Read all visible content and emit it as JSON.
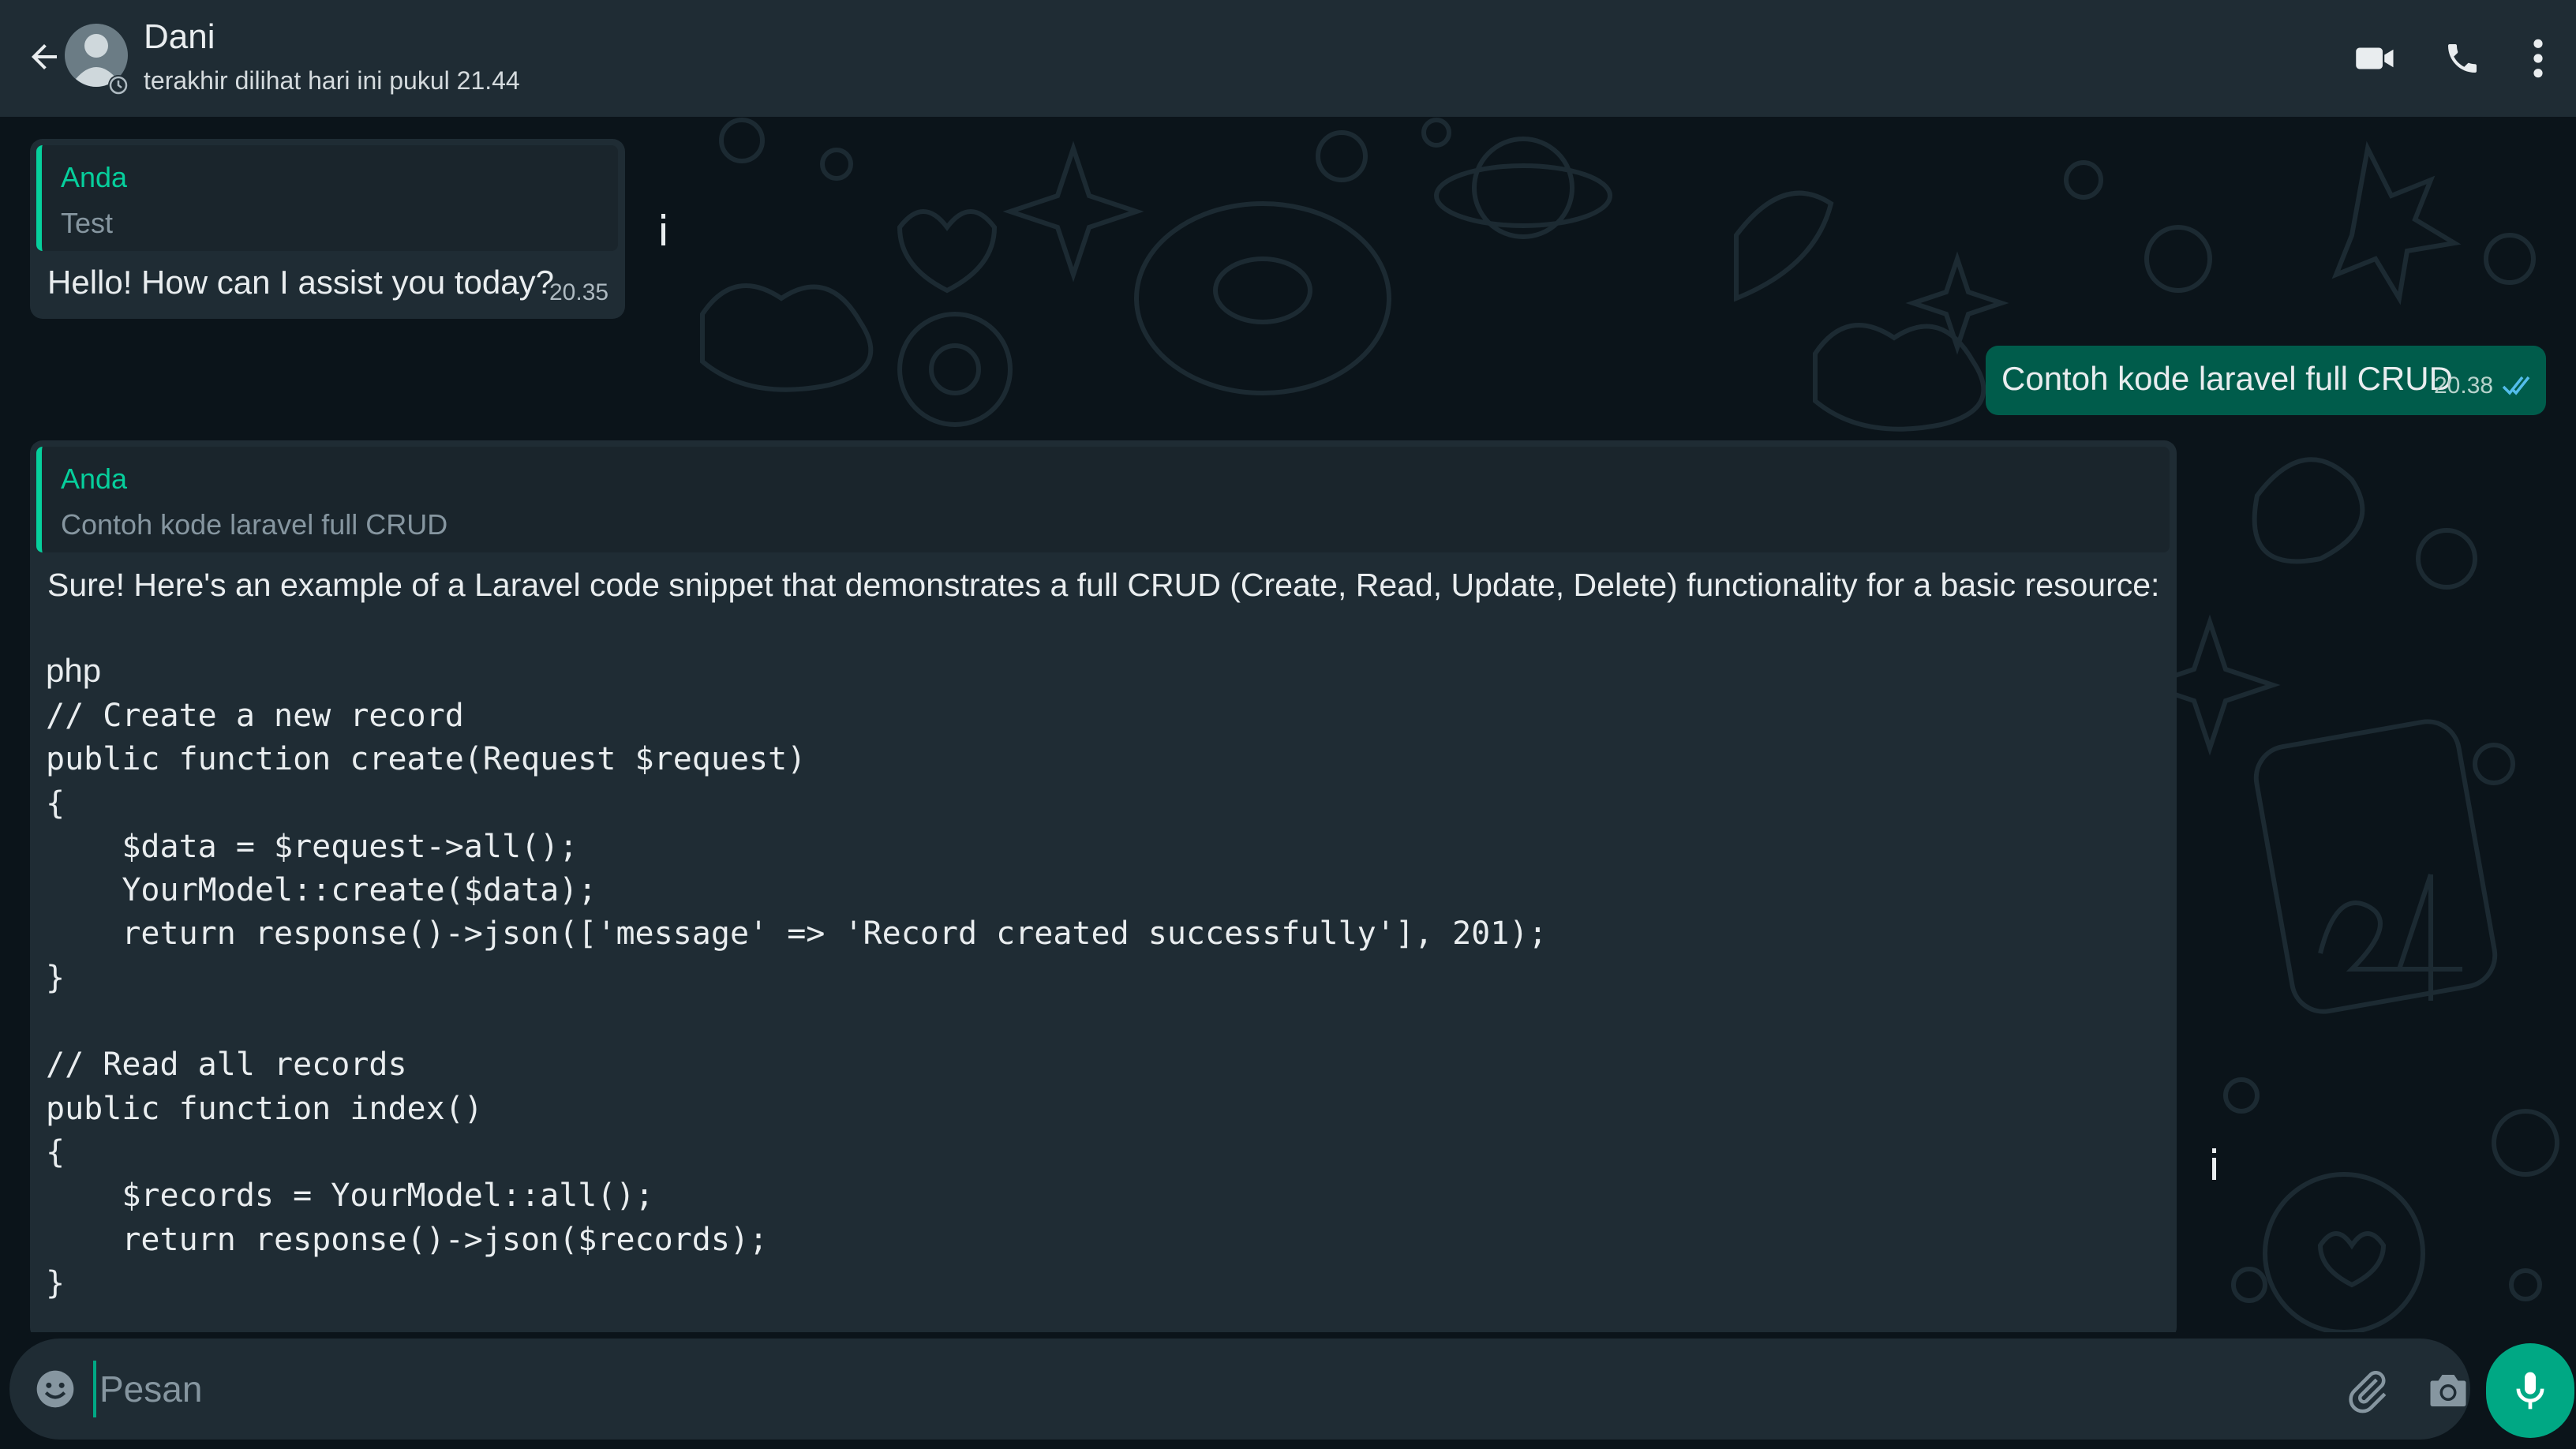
{
  "header": {
    "contact_name": "Dani",
    "status": "terakhir dilihat hari ini pukul 21.44"
  },
  "messages": [
    {
      "direction": "incoming",
      "quote_author": "Anda",
      "quote_text": "Test",
      "text": "Hello! How can I assist you today?",
      "time": "20.35"
    },
    {
      "direction": "outgoing",
      "text": "Contoh kode laravel full CRUD",
      "time": "20.38",
      "status": "read"
    },
    {
      "direction": "incoming",
      "quote_author": "Anda",
      "quote_text": "Contoh kode laravel full CRUD",
      "intro": "Sure! Here's an example of a Laravel code snippet that demonstrates a full CRUD (Create, Read, Update, Delete) functionality for a basic resource:",
      "code_lang": "php",
      "code_lines": [
        "// Create a new record",
        "public function create(Request $request)",
        "{",
        "    $data = $request->all();",
        "    YourModel::create($data);",
        "    return response()->json(['message' => 'Record created successfully'], 201);",
        "}",
        "",
        "// Read all records",
        "public function index()",
        "{",
        "    $records = YourModel::all();",
        "    return response()->json($records);",
        "}"
      ]
    }
  ],
  "input": {
    "placeholder": "Pesan",
    "value": ""
  },
  "icons": {
    "back": "arrow-left-icon",
    "video": "video-call-icon",
    "call": "phone-icon",
    "menu": "more-vertical-icon",
    "emoji": "emoji-icon",
    "attach": "paperclip-icon",
    "camera": "camera-icon",
    "mic": "microphone-icon"
  },
  "colors": {
    "header_bg": "#1f2c34",
    "chat_bg": "#0b141a",
    "incoming_bubble": "#1f2c34",
    "outgoing_bubble": "#005c4b",
    "accent": "#00a884",
    "quote_author": "#06cf9c",
    "read_tick": "#53bdeb"
  }
}
